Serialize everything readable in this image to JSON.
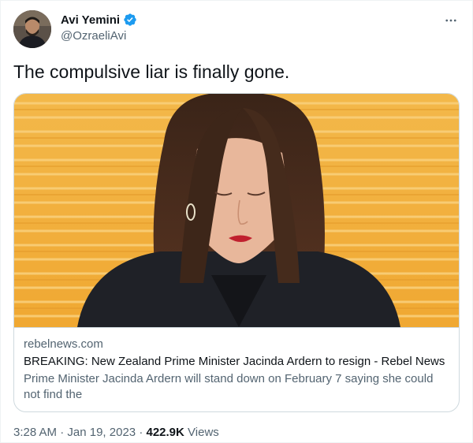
{
  "author": {
    "display_name": "Avi Yemini",
    "handle": "@OzraeliAvi",
    "verified": true,
    "verified_color": "#1d9bf0"
  },
  "tweet": {
    "text": "The compulsive liar is finally gone."
  },
  "card": {
    "domain": "rebelnews.com",
    "title": "BREAKING: New Zealand Prime Minister Jacinda Ardern to resign - Rebel News",
    "description": "Prime Minister Jacinda Ardern will stand down on February 7 saying she could not find the"
  },
  "meta": {
    "time": "3:28 AM",
    "separator1": "·",
    "date": "Jan 19, 2023",
    "separator2": "·",
    "views_count": "422.9K",
    "views_label": "Views"
  },
  "icons": {
    "verified": "verified-badge-icon",
    "more": "more-horizontal-icon"
  }
}
